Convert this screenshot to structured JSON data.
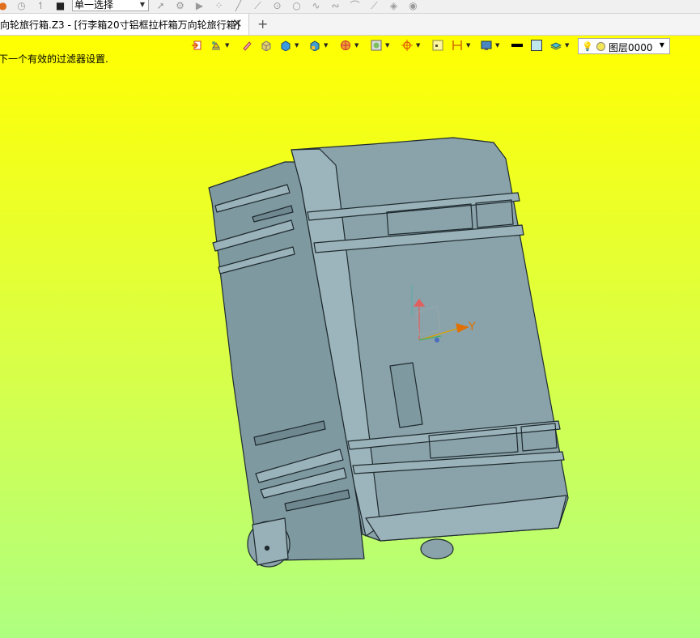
{
  "toolbar": {
    "select_mode": "单一选择"
  },
  "tabs": {
    "doc_title": "向轮旅行箱.Z3 - [行李箱20寸铝框拉杆箱万向轮旅行箱]",
    "close_glyph": "✕",
    "new_tab_glyph": "+"
  },
  "viewport": {
    "status_message": "下一个有效的过滤器设置.",
    "layer": "图层0000",
    "axis_label": "Y",
    "background_top": "#ffff00",
    "background_bottom": "#aeff80",
    "model_color": "#8aa3ab"
  },
  "icons": [
    "history-icon",
    "undo-icon",
    "stop-icon",
    "pointer-icon",
    "filter-icon",
    "play-icon",
    "snap-icon",
    "line-icon",
    "point-icon",
    "circle-icon",
    "curve-icon",
    "arc-icon",
    "layer-stack-icon",
    "exit-icon",
    "render-icon",
    "pen-icon",
    "box-icon",
    "solid-icon",
    "view-cube-icon",
    "sphere-icon",
    "frame-icon",
    "target-icon",
    "select-icon",
    "dimension-icon",
    "display-icon",
    "line-color-icon",
    "fill-color-icon",
    "layer-icon",
    "bulb-icon"
  ]
}
